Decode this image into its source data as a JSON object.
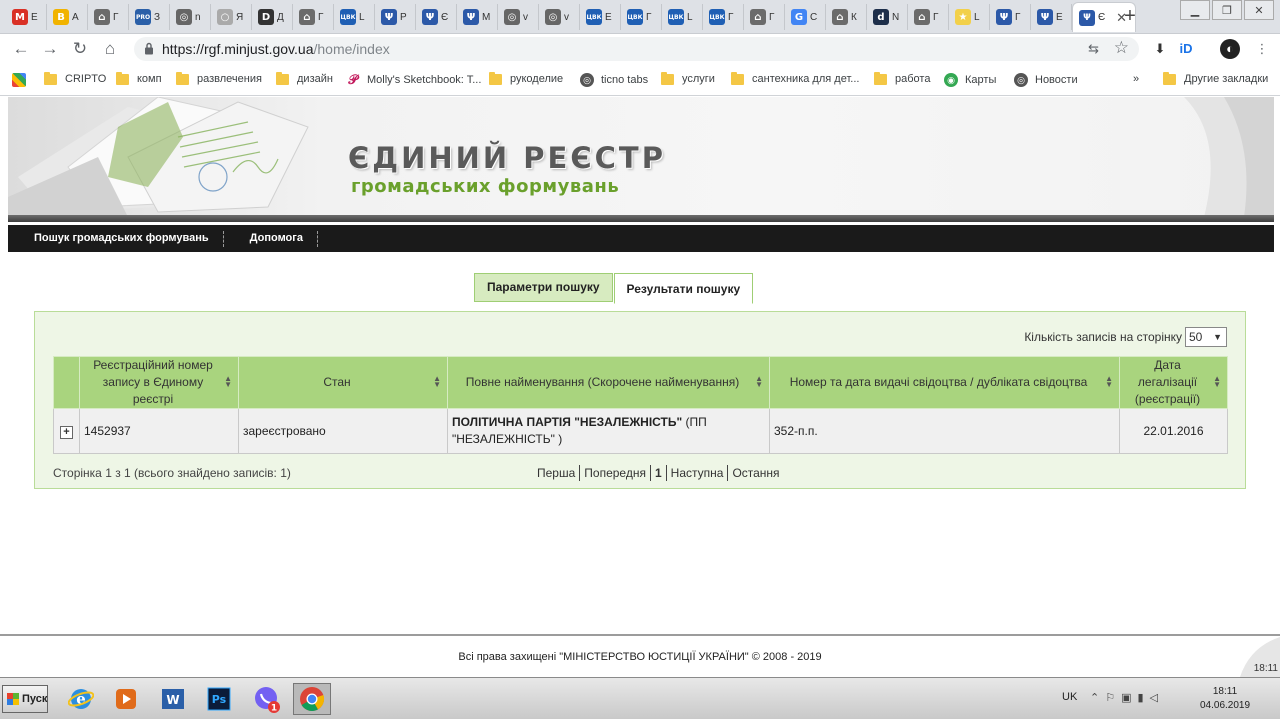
{
  "browser": {
    "tabs": [
      {
        "icon": "gmail-icon",
        "text": "M",
        "color": "#d93025",
        "label": "E"
      },
      {
        "icon": "b-icon",
        "text": "B",
        "color": "#f1b300",
        "label": "A"
      },
      {
        "icon": "gov-icon",
        "text": "⌂",
        "color": "#6b6b6b",
        "label": "Г"
      },
      {
        "icon": "pro-icon",
        "text": "PRO",
        "color": "#2a5fa8",
        "label": "З"
      },
      {
        "icon": "globe-icon",
        "text": "◎",
        "color": "#666",
        "label": "n"
      },
      {
        "icon": "loading-icon",
        "text": "○",
        "color": "#aaa",
        "label": "Я"
      },
      {
        "icon": "d-icon",
        "text": "D",
        "color": "#333",
        "label": "Д"
      },
      {
        "icon": "gov-icon",
        "text": "⌂",
        "color": "#6b6b6b",
        "label": "Г"
      },
      {
        "icon": "cvk-icon",
        "text": "ЦВК",
        "color": "#1f5fb4",
        "label": "L"
      },
      {
        "icon": "trident-icon",
        "text": "Ψ",
        "color": "#2c59a8",
        "label": "Р"
      },
      {
        "icon": "trident-icon",
        "text": "Ψ",
        "color": "#2c59a8",
        "label": "Є"
      },
      {
        "icon": "trident-icon",
        "text": "Ψ",
        "color": "#2c59a8",
        "label": "М"
      },
      {
        "icon": "globe-icon",
        "text": "◎",
        "color": "#666",
        "label": "v"
      },
      {
        "icon": "globe-icon",
        "text": "◎",
        "color": "#666",
        "label": "v"
      },
      {
        "icon": "cvk-icon",
        "text": "ЦВК",
        "color": "#1f5fb4",
        "label": "Е"
      },
      {
        "icon": "cvk-icon",
        "text": "ЦВК",
        "color": "#1f5fb4",
        "label": "Г"
      },
      {
        "icon": "cvk-icon",
        "text": "ЦВК",
        "color": "#1f5fb4",
        "label": "L"
      },
      {
        "icon": "cvk-icon",
        "text": "ЦВК",
        "color": "#1f5fb4",
        "label": "Г"
      },
      {
        "icon": "gov-icon",
        "text": "⌂",
        "color": "#6b6b6b",
        "label": "Г"
      },
      {
        "icon": "google-icon",
        "text": "G",
        "color": "#4285f4",
        "label": "С"
      },
      {
        "icon": "gov-icon",
        "text": "⌂",
        "color": "#6b6b6b",
        "label": "К"
      },
      {
        "icon": "d-icon",
        "text": "d",
        "color": "#1d2e4a",
        "label": "N"
      },
      {
        "icon": "gov-icon",
        "text": "⌂",
        "color": "#6b6b6b",
        "label": "Г"
      },
      {
        "icon": "star-fav-icon",
        "text": "★",
        "color": "#f2d04a",
        "label": "L"
      },
      {
        "icon": "trident-icon",
        "text": "Ψ",
        "color": "#2c59a8",
        "label": "Г"
      },
      {
        "icon": "trident-icon",
        "text": "Ψ",
        "color": "#2c59a8",
        "label": "Е"
      }
    ],
    "active_tab": {
      "label": "Є",
      "close": "✕"
    },
    "new_tab": "+",
    "url_host": "https://rgf.minjust.gov.ua",
    "url_path": "/home/index",
    "bookmarks": [
      {
        "label": "CRIPTO",
        "type": "folder"
      },
      {
        "label": "комп",
        "type": "folder"
      },
      {
        "label": "развлечения",
        "type": "folder"
      },
      {
        "label": "дизайн",
        "type": "folder"
      },
      {
        "label": "Molly's Sketchbook: T...",
        "type": "pinterest"
      },
      {
        "label": "рукоделие",
        "type": "folder"
      },
      {
        "label": "ticno tabs",
        "type": "globe"
      },
      {
        "label": "услуги",
        "type": "folder"
      },
      {
        "label": "сантехника для дет...",
        "type": "folder"
      },
      {
        "label": "работа",
        "type": "folder"
      },
      {
        "label": "Карты",
        "type": "maps"
      },
      {
        "label": "Новости",
        "type": "globe"
      }
    ],
    "bookmarks_more": "»",
    "other_bookmarks": "Другие закладки"
  },
  "site": {
    "title": "ЄДИНИЙ РЕЄСТР",
    "subtitle": "громадських формувань",
    "nav": [
      "Пошук громадських формувань",
      "Допомога"
    ]
  },
  "search": {
    "tabs": [
      "Параметри пошуку",
      "Результати пошуку"
    ],
    "active_tab": "Результати пошуку",
    "per_page_label": "Кількість записів на сторінку",
    "per_page_value": "50",
    "columns": [
      "Реєстраційний номер запису в Єдиному реєстрі",
      "Стан",
      "Повне найменування (Скорочене найменування)",
      "Номер та дата видачі свідоцтва / дубліката свідоцтва",
      "Дата легалізації (реєстрації)"
    ],
    "rows": [
      {
        "reg_number": "1452937",
        "status": "зареєстровано",
        "full_name": "ПОЛІТИЧНА ПАРТІЯ \"НЕЗАЛЕЖНІСТЬ\"",
        "short_name": "(ПП \"НЕЗАЛЕЖНІСТЬ\" )",
        "certificate": "352-п.п.",
        "legalization_date": "22.01.2016"
      }
    ],
    "page_info": "Сторінка 1 з 1 (всього знайдено записів: 1)",
    "pager": {
      "first": "Перша",
      "prev": "Попередня",
      "current": "1",
      "next": "Наступна",
      "last": "Остання"
    }
  },
  "footer": {
    "text": "Всі права захищені \"МІНІСТЕРСТВО ЮСТИЦІЇ УКРАЇНИ\" © 2008 - 2019",
    "corner_time": "18:11"
  },
  "taskbar": {
    "start": "Пуск",
    "lang": "UK",
    "time": "18:11",
    "date": "04.06.2019",
    "viber_badge": "1"
  }
}
